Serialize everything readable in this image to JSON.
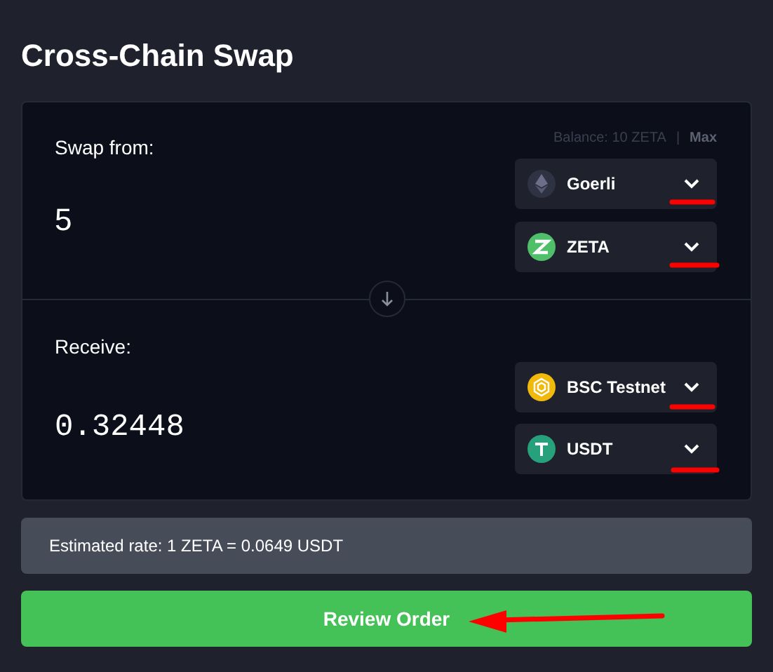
{
  "title": "Cross-Chain Swap",
  "swap_from": {
    "label": "Swap from:",
    "balance": "Balance: 10 ZETA",
    "separator": "|",
    "max": "Max",
    "amount": "5",
    "network": "Goerli",
    "token": "ZETA"
  },
  "receive": {
    "label": "Receive:",
    "amount": "0.32448",
    "network": "BSC Testnet",
    "token": "USDT"
  },
  "rate": "Estimated rate: 1 ZETA = 0.0649 USDT",
  "button": "Review Order"
}
